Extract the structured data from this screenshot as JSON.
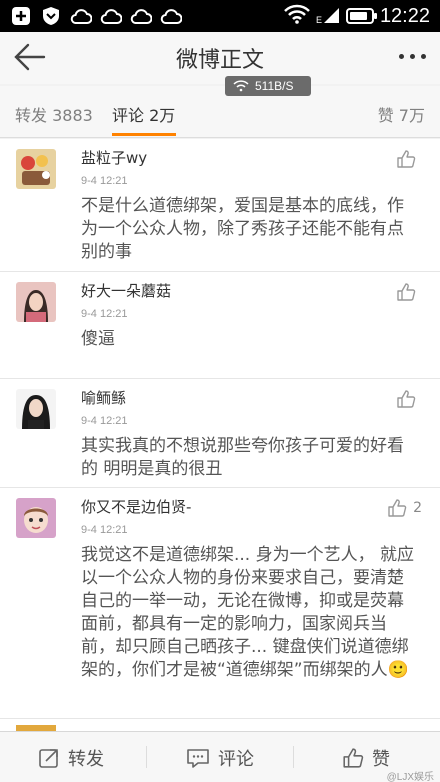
{
  "status_bar": {
    "time": "12:22"
  },
  "app_bar": {
    "title": "微博正文"
  },
  "network_speed": "511B/S",
  "tabs": {
    "repost": "转发 3883",
    "comments": "评论 2万",
    "likes": "赞 7万"
  },
  "comments": [
    {
      "name": "盐粒子wy",
      "time": "9-4 12:21",
      "text": "不是什么道德绑架，爱国是基本的底线，作为一个公众人物，除了秀孩子还能不能有点别的事",
      "likes": ""
    },
    {
      "name": "好大一朵蘑菇",
      "time": "9-4 12:21",
      "text": "傻逼",
      "likes": ""
    },
    {
      "name": "喻鲕鲧",
      "time": "9-4 12:21",
      "text": "其实我真的不想说那些夸你孩子可爱的好看的 明明是真的很丑",
      "likes": ""
    },
    {
      "name": "你又不是边伯贤-",
      "time": "9-4 12:21",
      "text": "我觉这不是道德绑架... 身为一个艺人， 就应以一个公众人物的身份来要求自己，要清楚自己的一举一动，无论在微博，抑或是荧幕面前，都具有一定的影响力，国家阅兵当前，却只顾自己晒孩子... 键盘侠们说道德绑架的，你们才是被“道德绑架”而绑架的人🙂",
      "likes": "2"
    }
  ],
  "bottom_bar": {
    "repost": "转发",
    "comment": "评论",
    "like": "赞"
  },
  "watermark": "@LJX娱乐"
}
